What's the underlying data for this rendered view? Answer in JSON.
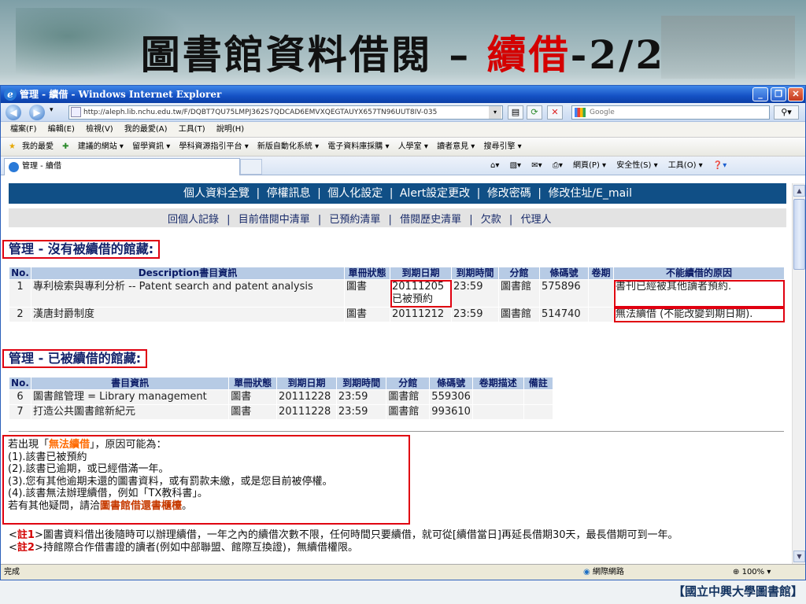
{
  "slide": {
    "title_main": "圖書館資料借閱 – ",
    "title_red": "續借",
    "title_suffix": "-2/2",
    "credit": "【國立中興大學圖書館】"
  },
  "window": {
    "title": "管理 - 續借 - Windows Internet Explorer",
    "url": "http://aleph.lib.nchu.edu.tw/F/DQBT7QU75LMPJ362S7QDCAD6EMVXQEGTAUYX657TN96UUT8IV-035",
    "search_placeholder": "Google",
    "menu": [
      "檔案(F)",
      "編輯(E)",
      "檢視(V)",
      "我的最愛(A)",
      "工具(T)",
      "說明(H)"
    ],
    "favorites": [
      "我的最愛",
      "建議的網站 ▾",
      "留學資訊 ▾",
      "學科資源指引平台 ▾",
      "新版自動化系統 ▾",
      "電子資料庫採購 ▾",
      "人學室 ▾",
      "讀者意見 ▾",
      "搜尋引擎 ▾"
    ],
    "tab_title": "管理 - 續借",
    "command_bar": [
      "網頁(P) ▾",
      "安全性(S) ▾",
      "工具(O) ▾"
    ],
    "status_left": "完成",
    "status_zone": "網際網路",
    "zoom": "100%"
  },
  "nav": {
    "items": [
      "個人資料全覽",
      "|",
      "停權訊息",
      "|",
      "個人化設定",
      "|",
      "Alert設定更改",
      "|",
      "修改密碼",
      "|",
      "修改住址/E_mail"
    ]
  },
  "subnav": {
    "items": [
      "回個人記錄",
      "|",
      "目前借閱中清單",
      "|",
      "已預約清單",
      "|",
      "借閱歷史清單",
      "|",
      "欠款",
      "|",
      "代理人"
    ]
  },
  "not_renewed": {
    "heading": "管理 - 沒有被續借的館藏:",
    "headers": [
      "No.",
      "Description書目資訊",
      "單冊狀態",
      "到期日期",
      "到期時間",
      "分館",
      "條碼號",
      "卷期",
      "不能續借的原因"
    ],
    "rows": [
      {
        "no": "1",
        "desc": "專利檢索與專利分析 -- Patent search and patent analysis",
        "status": "圖書",
        "due": "20111205 已被預約",
        "time": "23:59",
        "branch": "圖書館",
        "barcode": "575896",
        "vol": "",
        "reason": "書刊已經被其他讀者預約."
      },
      {
        "no": "2",
        "desc": "漢唐封爵制度",
        "status": "圖書",
        "due": "20111212",
        "time": "23:59",
        "branch": "圖書館",
        "barcode": "514740",
        "vol": "",
        "reason": "無法續借 (不能改變到期日期)."
      }
    ]
  },
  "renewed": {
    "heading": "管理 - 已被續借的館藏:",
    "headers": [
      "No.",
      "書目資訊",
      "單冊狀態",
      "到期日期",
      "到期時間",
      "分館",
      "條碼號",
      "卷期描述",
      "備註"
    ],
    "rows": [
      {
        "no": "6",
        "desc": "圖書館管理 = Library management",
        "status": "圖書",
        "due": "20111228",
        "time": "23:59",
        "branch": "圖書館",
        "barcode": "559306",
        "vol": "",
        "note": ""
      },
      {
        "no": "7",
        "desc": "打造公共圖書館新紀元",
        "status": "圖書",
        "due": "20111228",
        "time": "23:59",
        "branch": "圖書館",
        "barcode": "993610",
        "vol": "",
        "note": ""
      }
    ]
  },
  "notes": {
    "intro_a": "若出現「",
    "intro_b": "無法續借",
    "intro_c": "」，原因可能為：",
    "lines": [
      "(1).該書已被預約",
      "(2).該書已逾期，或已經借滿一年。",
      "(3).您有其他逾期未還的圖書資料，或有罰款未繳，或是您目前被停權。",
      "(4).該書無法辦理續借，例如「TX教科書」。"
    ],
    "contact_a": "若有其他疑問，請洽",
    "contact_b": "圖書館借還書櫃檯",
    "contact_c": "。"
  },
  "footnote": {
    "a": "<",
    "b": "註1",
    "c": ">圖書資料借出後隨時可以辦理續借，一年之內的續借次數不限，任何時間只要續借，就可從[續借當日]再延長借期30天，最長借期可到一年。",
    "d": "<",
    "e": "註2",
    "f": ">持館際合作借書證的讀者(例如中部聯盟、館際互換證)，無續借權限。"
  }
}
